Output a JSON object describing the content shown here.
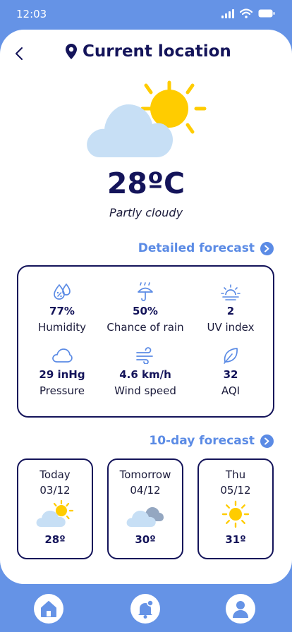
{
  "status_bar": {
    "time": "12:03",
    "icons": [
      "signal-icon",
      "wifi-icon",
      "battery-icon"
    ]
  },
  "header": {
    "back_icon": "chevron-left-icon",
    "pin_icon": "location-pin-icon",
    "title": "Current location"
  },
  "current": {
    "icon": "partly-cloudy-icon",
    "temperature": "28ºC",
    "condition": "Partly cloudy"
  },
  "detailed_link": {
    "label": "Detailed forecast",
    "icon": "arrow-right-circle-icon"
  },
  "details": [
    {
      "icon": "humidity-icon",
      "value": "77%",
      "label": "Humidity"
    },
    {
      "icon": "umbrella-rain-icon",
      "value": "50%",
      "label": "Chance of rain"
    },
    {
      "icon": "uv-sun-icon",
      "value": "2",
      "label": "UV index"
    },
    {
      "icon": "cloud-outline-icon",
      "value": "29 inHg",
      "label": "Pressure"
    },
    {
      "icon": "wind-icon",
      "value": "4.6 km/h",
      "label": "Wind speed"
    },
    {
      "icon": "leaf-icon",
      "value": "32",
      "label": "AQI"
    }
  ],
  "tenday_link": {
    "label": "10-day forecast",
    "icon": "arrow-right-circle-icon"
  },
  "forecast": [
    {
      "day": "Today",
      "date": "03/12",
      "icon": "partly-cloudy-icon",
      "temp": "28º"
    },
    {
      "day": "Tomorrow",
      "date": "04/12",
      "icon": "cloudy-icon",
      "temp": "30º"
    },
    {
      "day": "Thu",
      "date": "05/12",
      "icon": "sunny-icon",
      "temp": "31º"
    }
  ],
  "nav": [
    "home-icon",
    "notification-bell-icon",
    "profile-icon"
  ],
  "colors": {
    "accent": "#5B8BE5",
    "navy": "#14145A",
    "background": "#6593E6",
    "sun": "#FFCC00",
    "cloud": "#C7DFF5"
  }
}
